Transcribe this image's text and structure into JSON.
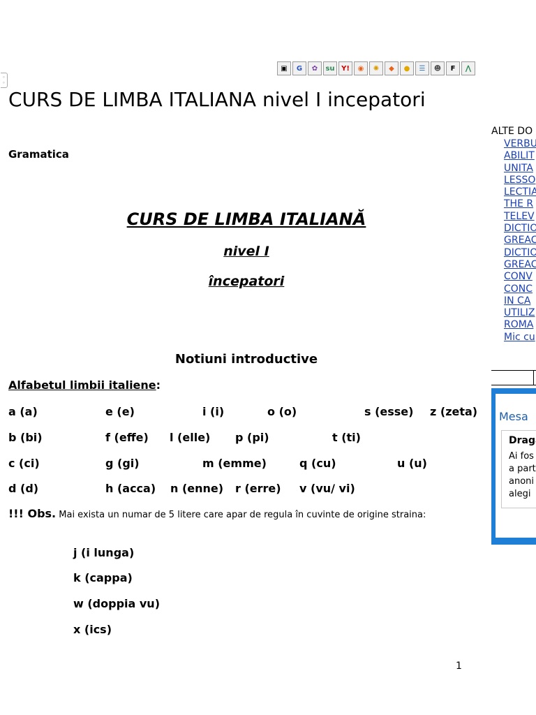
{
  "share_bar": {
    "buttons": [
      {
        "icon": "delicious-icon",
        "glyph": "▣",
        "color": "#000000"
      },
      {
        "icon": "google-icon",
        "glyph": "G",
        "color": "#2a56c6"
      },
      {
        "icon": "yahoo-myweb-icon",
        "glyph": "✿",
        "color": "#7a3fa0"
      },
      {
        "icon": "stumbleupon-icon",
        "glyph": "su",
        "color": "#2e8b57"
      },
      {
        "icon": "yahoo-icon",
        "glyph": "Y!",
        "color": "#cc0000"
      },
      {
        "icon": "blinklist-icon",
        "glyph": "◉",
        "color": "#e8641b"
      },
      {
        "icon": "technorati-icon",
        "glyph": "✺",
        "color": "#d99a00"
      },
      {
        "icon": "furl-icon",
        "glyph": "◆",
        "color": "#e8641b"
      },
      {
        "icon": "slashdot-icon",
        "glyph": "●",
        "color": "#e0a800"
      },
      {
        "icon": "newsvine-icon",
        "glyph": "☰",
        "color": "#3a78c2"
      },
      {
        "icon": "reddit-icon",
        "glyph": "☻",
        "color": "#555555"
      },
      {
        "icon": "facebook-icon",
        "glyph": "F",
        "color": "#000000"
      },
      {
        "icon": "spurl-icon",
        "glyph": "⋀",
        "color": "#2e8b57"
      }
    ]
  },
  "document": {
    "title": "CURS DE LIMBA ITALIANA nivel I incepatori",
    "category": "Gramatica",
    "heading_main": "CURS DE LIMBA ITALIANĂ",
    "heading_level": "nivel I",
    "heading_beginners": "începatori",
    "section_title": "Notiuni introductive",
    "alphabet_label": "Alfabetul limbii italiene",
    "alphabet_colon": ":",
    "alphabet_rows": [
      [
        "a (a)",
        "e (e)",
        "i (i)",
        "o (o)",
        "s (esse)",
        "z (zeta)"
      ],
      [
        "b (bi)",
        "f (effe)",
        "l (elle)",
        "p (pi)",
        "t (ti)"
      ],
      [
        "c (ci)",
        "g (gi)",
        "m (emme)",
        "q (cu)",
        "u (u)"
      ],
      [
        "d (d)",
        "h (acca)",
        "n (enne)",
        "r (erre)",
        "v (vu/ vi)"
      ]
    ],
    "obs_lead": "!!! Obs.",
    "obs_text": " Mai exista un numar de 5 litere care apar de regula în cuvinte de origine straina:",
    "extra_letters": [
      "j (i lunga)",
      "k (cappa)",
      "w (doppia vu)",
      "x (ics)"
    ],
    "page_number": "1"
  },
  "sidebar": {
    "heading": "ALTE DO",
    "links": [
      "VERBU",
      "ABILIT",
      "UNITA",
      "LESSO",
      "LECTIA",
      "THE R",
      "TELEV",
      "DICTIO",
      "GREAC",
      "DICTIO",
      "GREAC",
      "CONV",
      "CONC",
      "IN CA",
      "UTILIZ",
      "ROMA",
      "Mic cu"
    ]
  },
  "message_panel": {
    "title": "Mesa",
    "card_header": "Draga",
    "card_lines": [
      "Ai fos",
      "a part",
      "anoni",
      "alegi"
    ]
  },
  "colors": {
    "link": "#1a3fb5",
    "panel": "#1f7fd6"
  }
}
